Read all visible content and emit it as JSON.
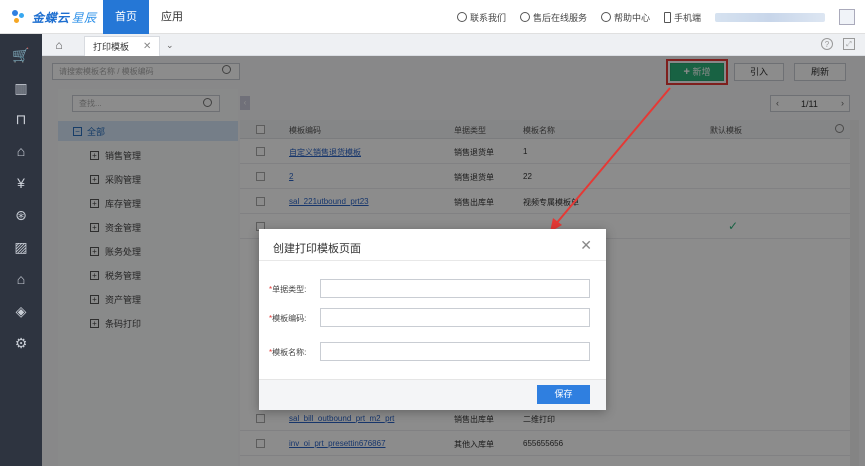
{
  "brand": {
    "name": "金蝶云",
    "sub": "星辰"
  },
  "nav": {
    "home": "首页",
    "apps": "应用"
  },
  "top_links": [
    {
      "label": "联系我们",
      "icon": "chat-icon"
    },
    {
      "label": "售后在线服务",
      "icon": "headset-icon"
    },
    {
      "label": "帮助中心",
      "icon": "help-icon"
    },
    {
      "label": "手机端",
      "icon": "phone-icon"
    }
  ],
  "tabs": {
    "current": "打印模板"
  },
  "toolbar": {
    "search_placeholder": "请搜索模板名称 / 模板编码",
    "new_label": "新增",
    "import_label": "引入",
    "refresh_label": "刷新"
  },
  "tree": {
    "search_placeholder": "查找...",
    "root": "全部",
    "items": [
      "销售管理",
      "采购管理",
      "库存管理",
      "资金管理",
      "账务处理",
      "税务管理",
      "资产管理",
      "条码打印"
    ]
  },
  "pager": {
    "text": "1/11"
  },
  "table": {
    "headers": [
      "模板编码",
      "单据类型",
      "模板名称",
      "默认模板"
    ],
    "rows": [
      {
        "code": "自定义销售退货模板",
        "type": "销售退货单",
        "name": "1",
        "default": ""
      },
      {
        "code": "2",
        "type": "销售退货单",
        "name": "22",
        "default": ""
      },
      {
        "code": "sal_221utbound_prt23",
        "type": "销售出库单",
        "name": "视频专属模板单",
        "default": ""
      },
      {
        "code": "",
        "type": "",
        "name": "",
        "default": "✓"
      },
      {
        "code": "sal_bill_outbound_prt_m2_prt",
        "type": "销售出库单",
        "name": "二维打印",
        "default": ""
      },
      {
        "code": "inv_oi_prt_presettin676867",
        "type": "其他入库单",
        "name": "655655656",
        "default": ""
      }
    ]
  },
  "modal": {
    "title": "创建打印模板页面",
    "fields": [
      "单据类型:",
      "模板编码:",
      "模板名称:"
    ],
    "required_mark": "*",
    "save_label": "保存"
  }
}
